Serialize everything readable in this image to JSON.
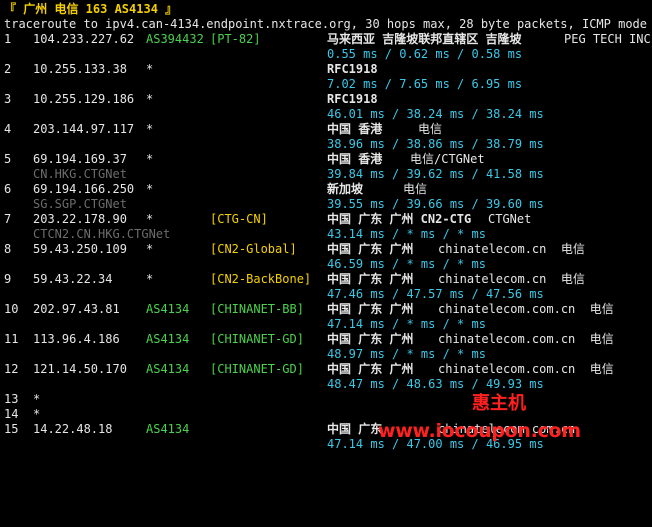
{
  "title_line": "『 广州 电信 163 AS4134 』",
  "command_line": "traceroute to ipv4.can-4134.endpoint.nxtrace.org, 30 hops max, 28 byte packets, ICMP mode",
  "colors": {
    "yellow": "#f5d000",
    "green": "#4cd14c",
    "cyan": "#3cc8e8",
    "gray": "#6c6c6c"
  },
  "hops": [
    {
      "num": "1",
      "ip": "104.233.227.62",
      "asn": "AS394432",
      "tag": "[PT-82]",
      "geo": "马来西亚 吉隆坡联邦直辖区 吉隆坡",
      "org": "PEG TECH INC",
      "rdns": "",
      "rtt": "0.55 ms / 0.62 ms / 0.58 ms"
    },
    {
      "num": "2",
      "ip": "10.255.133.38",
      "asn": "*",
      "tag": "",
      "geo": "RFC1918",
      "org": "",
      "rdns": "",
      "rtt": "7.02 ms / 7.65 ms / 6.95 ms"
    },
    {
      "num": "3",
      "ip": "10.255.129.186",
      "asn": "*",
      "tag": "",
      "geo": "RFC1918",
      "org": "",
      "rdns": "",
      "rtt": "46.01 ms / 38.24 ms / 38.24 ms"
    },
    {
      "num": "4",
      "ip": "203.144.97.117",
      "asn": "*",
      "tag": "",
      "geo": "中国 香港",
      "org": "电信",
      "rdns": "",
      "rtt": "38.96 ms / 38.86 ms / 38.79 ms"
    },
    {
      "num": "5",
      "ip": "69.194.169.37",
      "asn": "*",
      "tag": "",
      "geo": "中国 香港",
      "org": "电信/CTGNet",
      "rdns": "CN.HKG.CTGNet",
      "rtt": "39.84 ms / 39.62 ms / 41.58 ms"
    },
    {
      "num": "6",
      "ip": "69.194.166.250",
      "asn": "*",
      "tag": "",
      "geo": "新加坡",
      "org": "电信",
      "rdns": "SG.SGP.CTGNet",
      "rtt": "39.55 ms / 39.66 ms / 39.60 ms"
    },
    {
      "num": "7",
      "ip": "203.22.178.90",
      "asn": "*",
      "tag": "[CTG-CN]",
      "geo": "中国 广东 广州 CN2-CTG",
      "org": "CTGNet",
      "rdns": "CTCN2.CN.HKG.CTGNet",
      "rtt": "43.14 ms / * ms / * ms"
    },
    {
      "num": "8",
      "ip": "59.43.250.109",
      "asn": "*",
      "tag": "[CN2-Global]",
      "geo": "中国 广东 广州",
      "org": "chinatelecom.cn  电信",
      "rdns": "",
      "rtt": "46.59 ms / * ms / * ms"
    },
    {
      "num": "9",
      "ip": "59.43.22.34",
      "asn": "*",
      "tag": "[CN2-BackBone]",
      "geo": "中国 广东 广州",
      "org": "chinatelecom.cn  电信",
      "rdns": "",
      "rtt": "47.46 ms / 47.57 ms / 47.56 ms"
    },
    {
      "num": "10",
      "ip": "202.97.43.81",
      "asn": "AS4134",
      "tag": "[CHINANET-BB]",
      "geo": "中国 广东 广州",
      "org": "chinatelecom.com.cn  电信",
      "rdns": "",
      "rtt": "47.14 ms / * ms / * ms"
    },
    {
      "num": "11",
      "ip": "113.96.4.186",
      "asn": "AS4134",
      "tag": "[CHINANET-GD]",
      "geo": "中国 广东 广州",
      "org": "chinatelecom.com.cn  电信",
      "rdns": "",
      "rtt": "48.97 ms / * ms / * ms"
    },
    {
      "num": "12",
      "ip": "121.14.50.170",
      "asn": "AS4134",
      "tag": "[CHINANET-GD]",
      "geo": "中国 广东 广州",
      "org": "chinatelecom.com.cn  电信",
      "rdns": "",
      "rtt": "48.47 ms / 48.63 ms / 49.93 ms"
    },
    {
      "num": "13",
      "ip": "*",
      "asn": "",
      "tag": "",
      "geo": "",
      "org": "",
      "rdns": "",
      "rtt": ""
    },
    {
      "num": "14",
      "ip": "*",
      "asn": "",
      "tag": "",
      "geo": "",
      "org": "",
      "rdns": "",
      "rtt": ""
    },
    {
      "num": "15",
      "ip": "14.22.48.18",
      "asn": "AS4134",
      "tag": "",
      "geo": "中国 广东",
      "org": "chinatelecom.com.cn",
      "rdns": "",
      "rtt": "47.14 ms / 47.00 ms / 46.95 ms"
    }
  ],
  "watermark": {
    "brand": "惠主机",
    "url": "www.iocoupon.com"
  }
}
